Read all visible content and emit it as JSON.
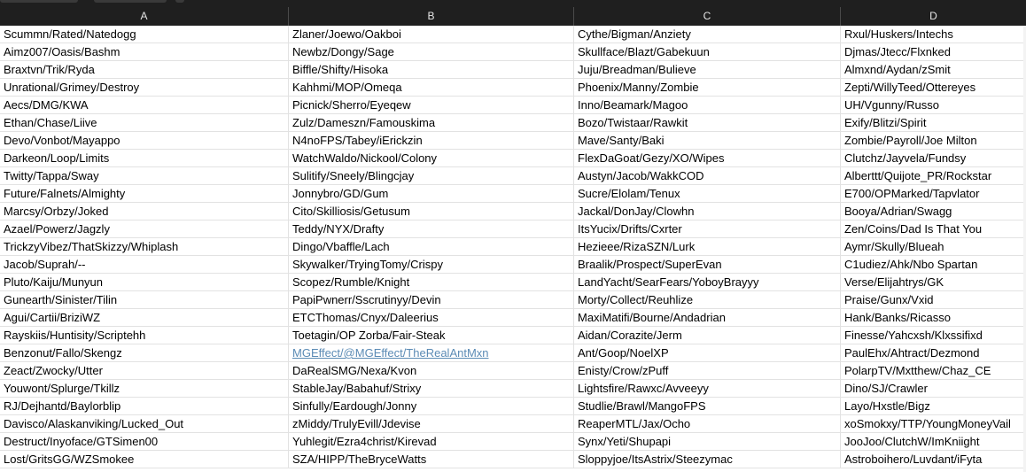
{
  "columns": [
    "A",
    "B",
    "C",
    "D"
  ],
  "rows": [
    [
      "Scummn/Rated/Natedogg",
      "Zlaner/Joewo/Oakboi",
      "Cythe/Bigman/Anziety",
      "Rxul/Huskers/Intechs"
    ],
    [
      "Aimz007/Oasis/Bashm",
      "Newbz/Dongy/Sage",
      "Skullface/Blazt/Gabekuun",
      "Djmas/Jtecc/Flxnked"
    ],
    [
      "Braxtvn/Trik/Ryda",
      "Biffle/Shifty/Hisoka",
      "Juju/Breadman/Bulieve",
      "Almxnd/Aydan/zSmit"
    ],
    [
      "Unrational/Grimey/Destroy",
      "Kahhmi/MOP/Omeqa",
      "Phoenix/Manny/Zombie",
      "Zepti/WillyTeed/Ottereyes"
    ],
    [
      "Aecs/DMG/KWA",
      "Picnick/Sherro/Eyeqew",
      "Inno/Beamark/Magoo",
      "UH/Vgunny/Russo"
    ],
    [
      "Ethan/Chase/Liive",
      "Zulz/Dameszn/Famouskima",
      "Bozo/Twistaar/Rawkit",
      "Exify/Blitzi/Spirit"
    ],
    [
      "Devo/Vonbot/Mayappo",
      "N4noFPS/Tabey/iErickzin",
      "Mave/Santy/Baki",
      "Zombie/Payroll/Joe Milton"
    ],
    [
      "Darkeon/Loop/Limits",
      "WatchWaldo/Nickool/Colony",
      "FlexDaGoat/Gezy/XO/Wipes",
      "Clutchz/Jayvela/Fundsy"
    ],
    [
      "Twitty/Tappa/Sway",
      "Sulitify/Sneely/Blingcjay",
      "Austyn/Jacob/WakkCOD",
      "Alberttt/Quijote_PR/Rockstar"
    ],
    [
      "Future/Falnets/Almighty",
      "Jonnybro/GD/Gum",
      "Sucre/Elolam/Tenux",
      "E700/OPMarked/Tapvlator"
    ],
    [
      "Marcsy/Orbzy/Joked",
      "Cito/Skilliosis/Getusum",
      "Jackal/DonJay/Clowhn",
      "Booya/Adrian/Swagg"
    ],
    [
      "Azael/Powerz/Jagzly",
      "Teddy/NYX/Drafty",
      "ItsYucix/Drifts/Cxrter",
      "Zen/Coins/Dad Is That You"
    ],
    [
      "TrickzyVibez/ThatSkizzy/Whiplash",
      "Dingo/Vbaffle/Lach",
      "Hezieee/RizaSZN/Lurk",
      "Aymr/Skully/Blueah"
    ],
    [
      "Jacob/Suprah/--",
      "Skywalker/TryingTomy/Crispy",
      "Braalik/Prospect/SuperEvan",
      "C1udiez/Ahk/Nbo Spartan"
    ],
    [
      "Pluto/Kaiju/Munyun",
      "Scopez/Rumble/Knight",
      "LandYacht/SearFears/YoboyBrayyy",
      "Verse/Elijahtrys/GK"
    ],
    [
      "Gunearth/Sinister/Tilin",
      "PapiPwnerr/Sscrutinyy/Devin",
      "Morty/Collect/Reuhlize",
      "Praise/Gunx/Vxid"
    ],
    [
      "Agui/Cartii/BriziWZ",
      "ETCThomas/Cnyx/Daleerius",
      "MaxiMatifi/Bourne/Andadrian",
      "Hank/Banks/Ricasso"
    ],
    [
      "Rayskiis/Huntisity/Scriptehh",
      "Toetagin/OP Zorba/Fair-Steak",
      "Aidan/Corazite/Jerm",
      "Finesse/Yahcxsh/Klxssifixd"
    ],
    [
      "Benzonut/Fallo/Skengz",
      "MGEffect/@MGEffect/TheRealAntMxn",
      "Ant/Goop/NoelXP",
      "PaulEhx/Ahtract/Dezmond"
    ],
    [
      "Zeact/Zwocky/Utter",
      "DaRealSMG/Nexa/Kvon",
      "Enisty/Crow/zPuff",
      "PolarpTV/Mxtthew/Chaz_CE"
    ],
    [
      "Youwont/Splurge/Tkillz",
      "StableJay/Babahuf/Strixy",
      "Lightsfire/Rawxc/Avveeyy",
      "Dino/SJ/Crawler"
    ],
    [
      "RJ/Dejhantd/Baylorblip",
      "Sinfully/Eardough/Jonny",
      "Studlie/Brawl/MangoFPS",
      "Layo/Hxstle/Bigz"
    ],
    [
      "Davisco/Alaskanviking/Lucked_Out",
      "zMiddy/TrulyEvill/Jdevise",
      "ReaperMTL/Jax/Ocho",
      "xoSmokxy/TTP/YoungMoneyVail"
    ],
    [
      "Destruct/Inyoface/GTSimen00",
      "Yuhlegit/Ezra4christ/Kirevad",
      "Synx/Yeti/Shupapi",
      "JooJoo/ClutchW/ImKniight"
    ],
    [
      "Lost/GritsGG/WZSmokee",
      "SZA/HIPP/TheBryceWatts",
      "Sloppyjoe/ItsAstrix/Steezymac",
      "Astroboihero/Luvdant/iFyta"
    ]
  ],
  "link_cell": {
    "row": 18,
    "col": 1
  },
  "colors": {
    "header_bg": "#1f1f1f",
    "header_text": "#e6e6e6",
    "link": "#5b8bb5",
    "gridline": "#e2e2e2"
  }
}
